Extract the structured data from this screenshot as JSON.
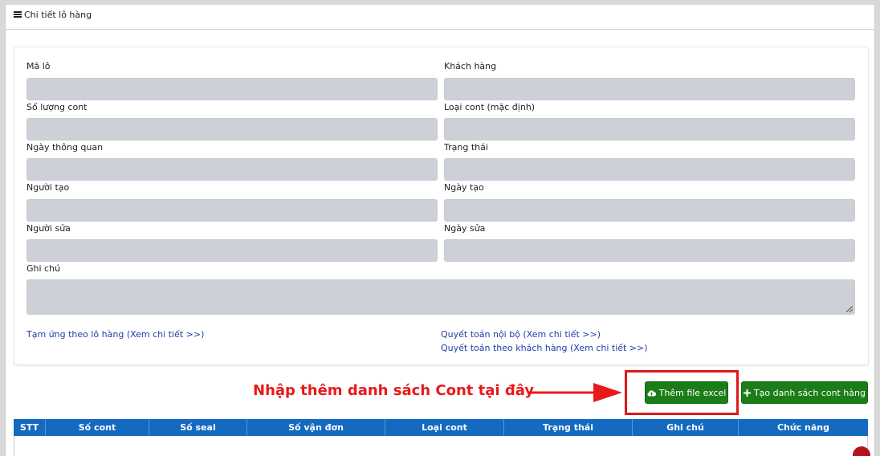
{
  "header": {
    "title": "Chi tiết lô hàng",
    "icon": "bars-icon"
  },
  "form": {
    "fields": [
      {
        "label": "Mã lô",
        "value": ""
      },
      {
        "label": "Khách hàng",
        "value": ""
      },
      {
        "label": "Số lượng cont",
        "value": ""
      },
      {
        "label": "Loại cont (mặc định)",
        "value": ""
      },
      {
        "label": "Ngày thông quan",
        "value": ""
      },
      {
        "label": "Trạng thái",
        "value": ""
      },
      {
        "label": "Người tạo",
        "value": ""
      },
      {
        "label": "Ngày tạo",
        "value": ""
      },
      {
        "label": "Người sửa",
        "value": ""
      },
      {
        "label": "Ngày sửa",
        "value": ""
      }
    ],
    "note": {
      "label": "Ghi chú",
      "value": ""
    }
  },
  "links": {
    "advance": "Tạm ứng theo lô hàng (Xem chi tiết >>)",
    "internal_settlement": "Quyết toán nội bộ (Xem chi tiết >>)",
    "customer_settlement": "Quyết toán theo khách hàng (Xem chi tiết >>)"
  },
  "annotation": {
    "text": "Nhập thêm danh sách Cont tại đây",
    "color": "#e8191b"
  },
  "buttons": {
    "add_excel": {
      "label": "Thêm file excel",
      "icon": "cloud-upload-icon"
    },
    "create_list": {
      "label": "Tạo danh sách cont hàng",
      "icon": "plus-icon"
    }
  },
  "table": {
    "columns": [
      "STT",
      "Số cont",
      "Số seal",
      "Số vận đơn",
      "Loại cont",
      "Trạng thái",
      "Ghi chú",
      "Chức năng"
    ],
    "rows": []
  },
  "colors": {
    "accent_blue": "#1469c0",
    "button_green": "#1b7d17",
    "link_blue": "#1f3ea8",
    "highlight_red": "#e01818"
  }
}
